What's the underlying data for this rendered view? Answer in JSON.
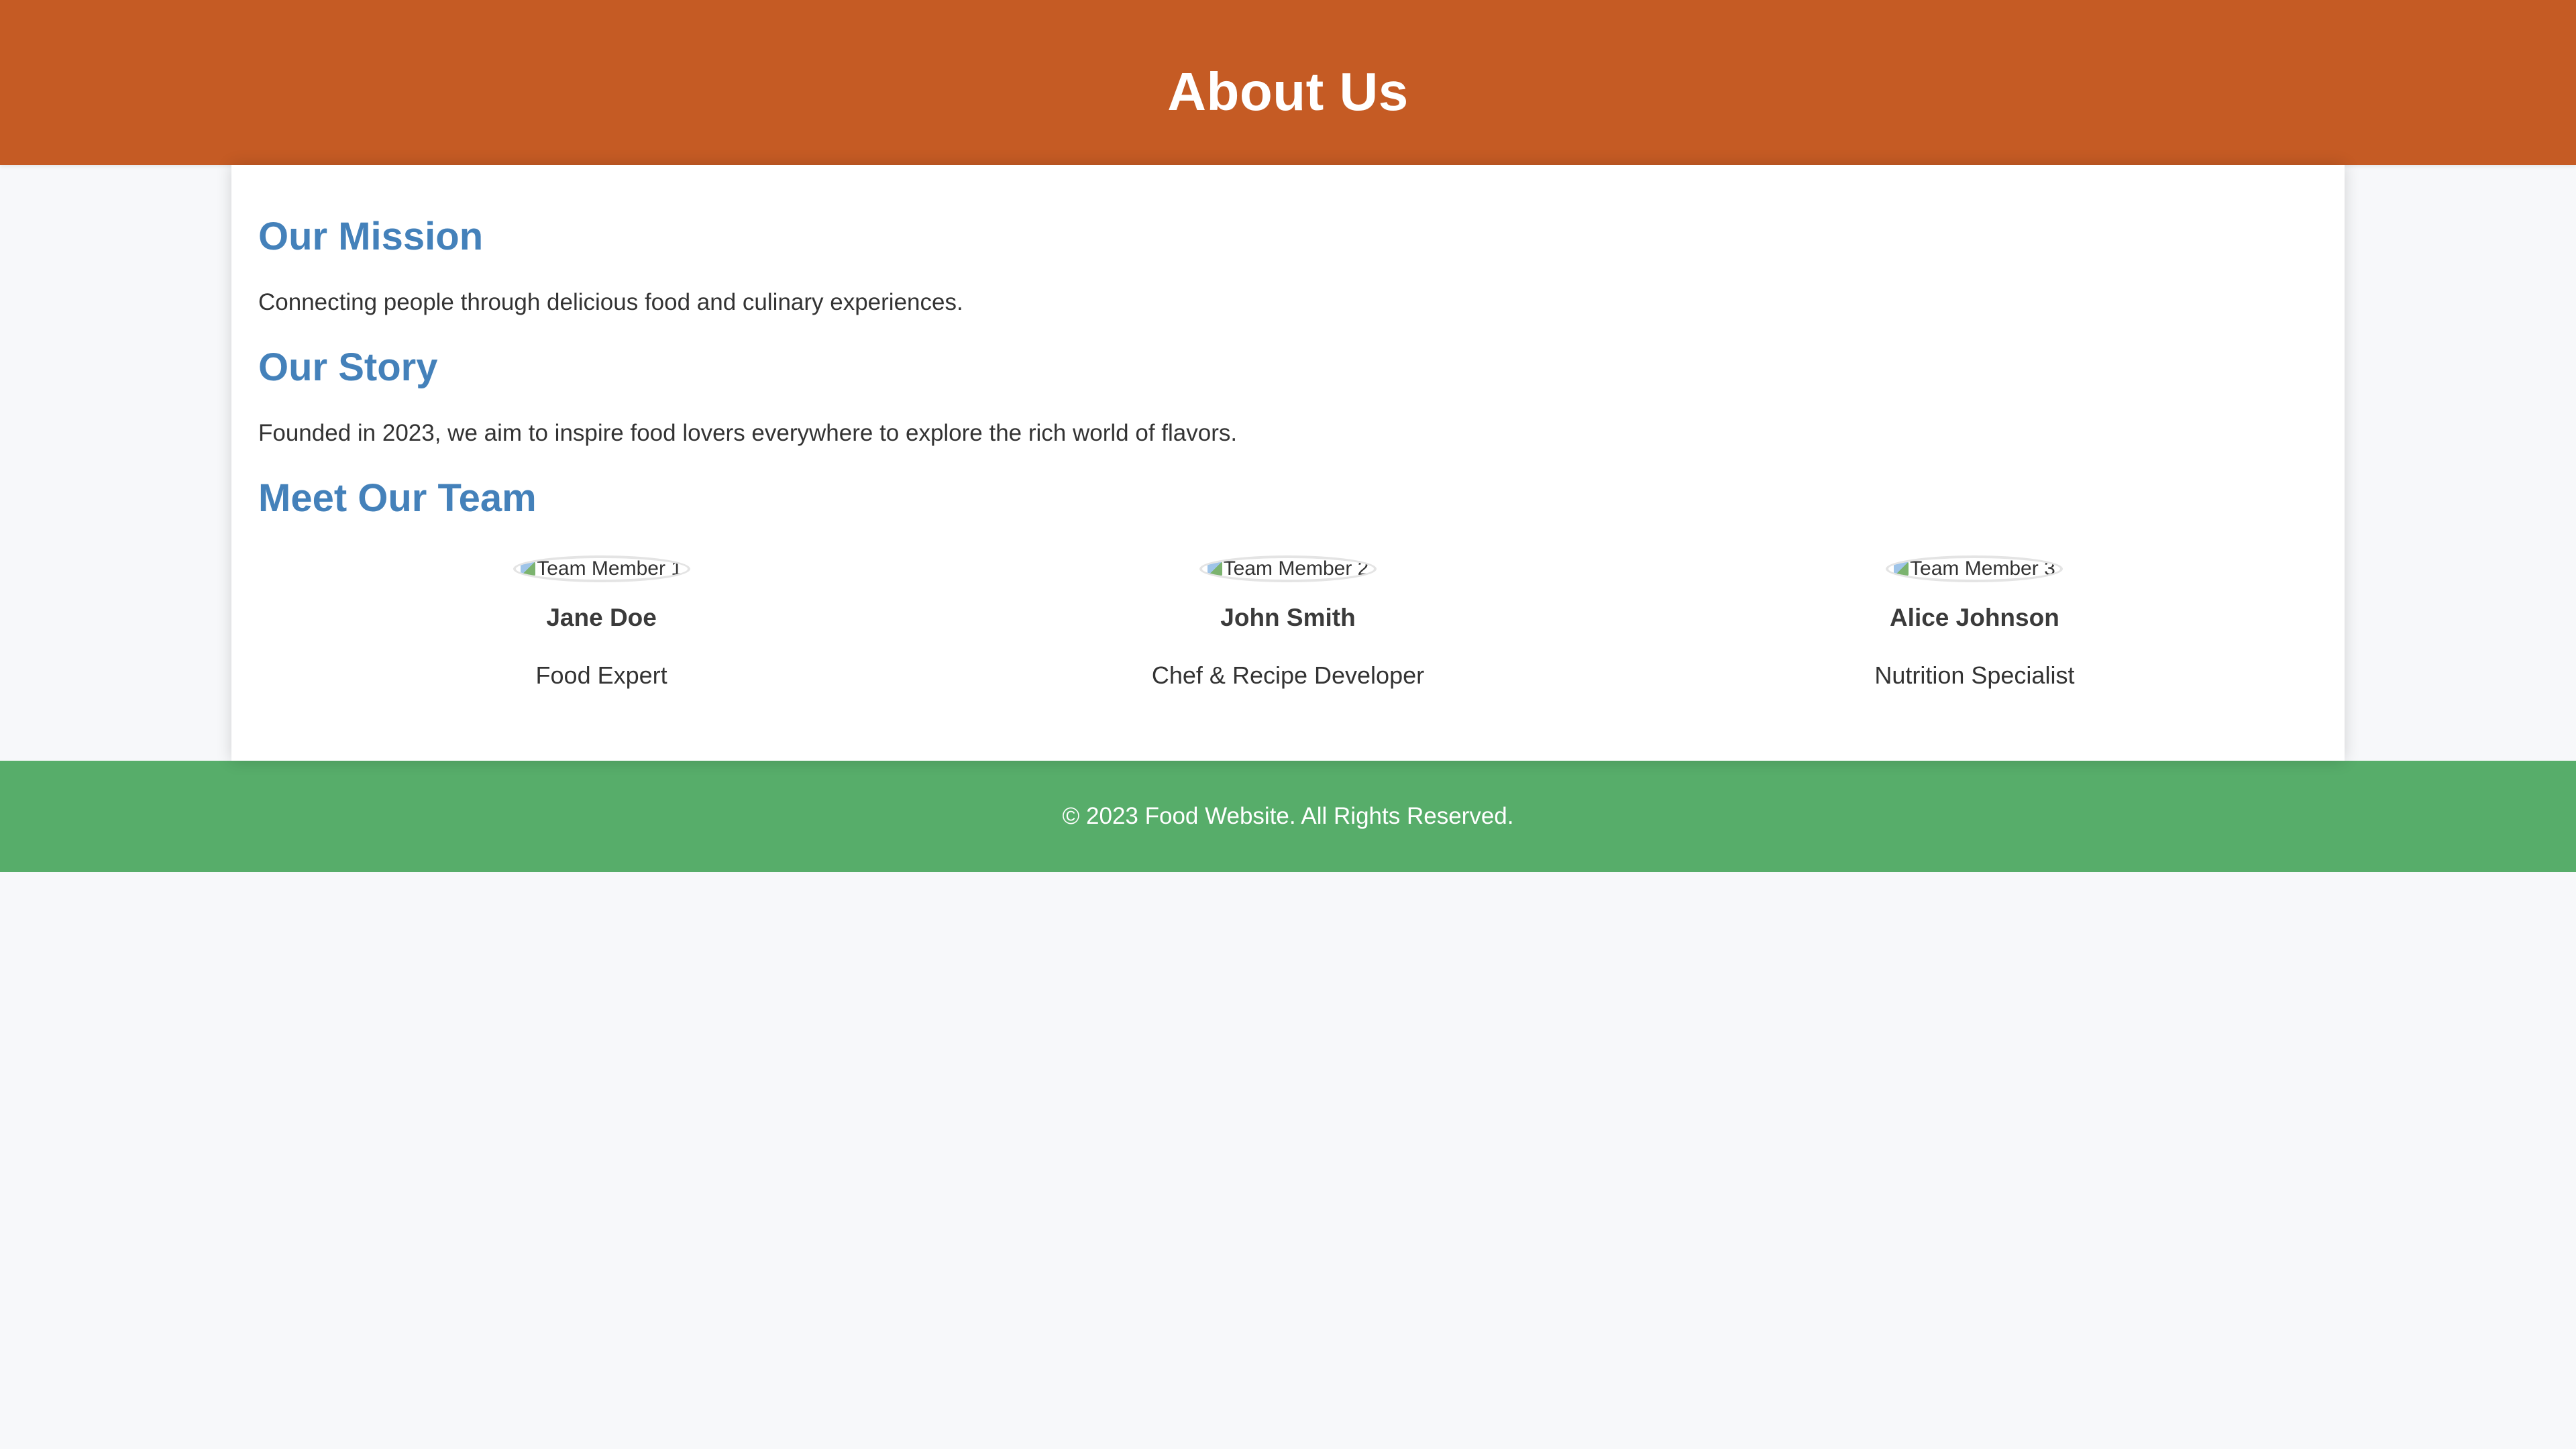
{
  "header": {
    "title": "About Us"
  },
  "mission": {
    "heading": "Our Mission",
    "text": "Connecting people through delicious food and culinary experiences."
  },
  "story": {
    "heading": "Our Story",
    "text": "Founded in 2023, we aim to inspire food lovers everywhere to explore the rich world of flavors."
  },
  "team": {
    "heading": "Meet Our Team",
    "members": [
      {
        "image_alt": "Team Member 1",
        "name": "Jane Doe",
        "role": "Food Expert"
      },
      {
        "image_alt": "Team Member 2",
        "name": "John Smith",
        "role": "Chef & Recipe Developer"
      },
      {
        "image_alt": "Team Member 3",
        "name": "Alice Johnson",
        "role": "Nutrition Specialist"
      }
    ]
  },
  "footer": {
    "text": "© 2023 Food Website. All Rights Reserved."
  },
  "colors": {
    "header_bg": "#c55b24",
    "heading_blue": "#4481ba",
    "footer_bg": "#57ad6a",
    "page_bg": "#f7f8fa"
  },
  "icons": {
    "broken_image": "broken-image-icon"
  }
}
